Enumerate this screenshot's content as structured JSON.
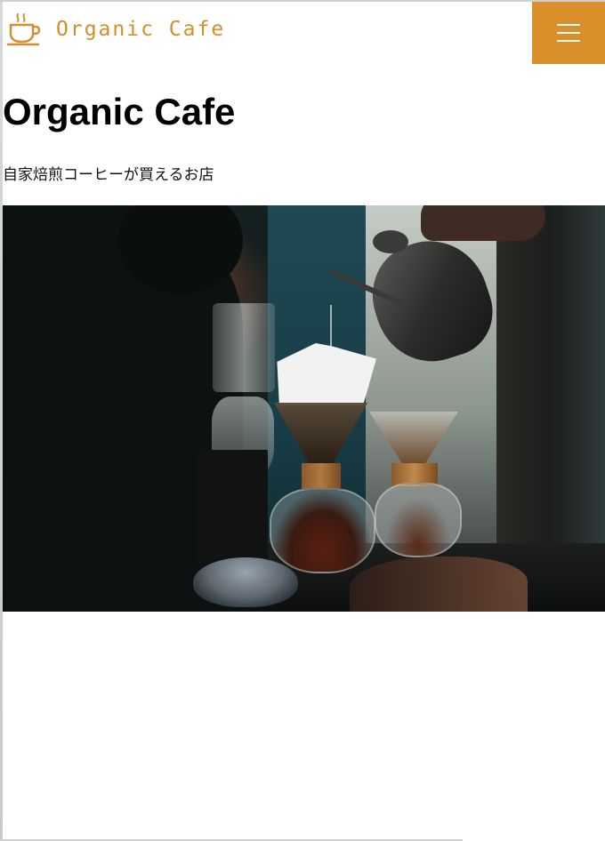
{
  "header": {
    "logo_text": "Organic Cafe",
    "logo_icon": "coffee-cup-icon",
    "menu_icon": "hamburger-menu-icon"
  },
  "main": {
    "title": "Organic Cafe",
    "subtitle": "自家焙煎コーヒーが買えるお店"
  },
  "colors": {
    "accent": "#d98f2a",
    "logo_text": "#d58e2c",
    "text": "#000000",
    "background": "#ffffff"
  }
}
